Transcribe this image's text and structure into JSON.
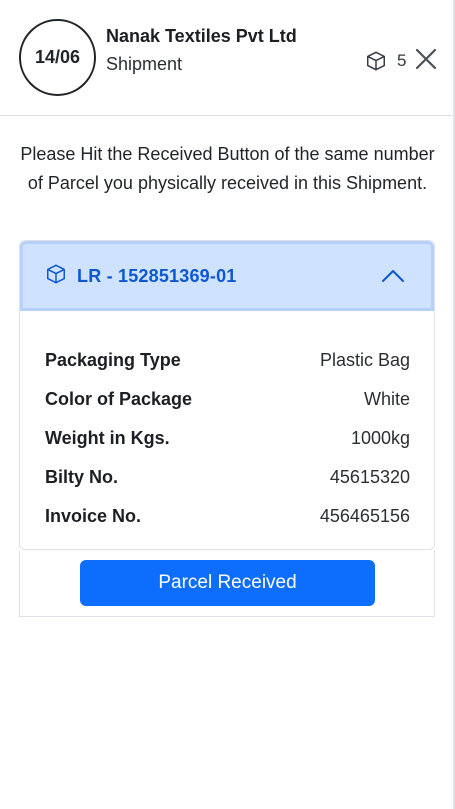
{
  "header": {
    "date": "14/06",
    "company": "Nanak Textiles Pvt Ltd",
    "subtitle": "Shipment",
    "parcel_count": "5",
    "box_icon": "box-icon",
    "close_icon": "close-icon"
  },
  "instruction": "Please Hit the Received Button of the same number of Parcel you physically received in this Shipment.",
  "parcel": {
    "lr_label": "LR - 152851369-01",
    "expanded": true,
    "details": [
      {
        "label": "Packaging Type",
        "value": "Plastic Bag"
      },
      {
        "label": "Color of Package",
        "value": "White"
      },
      {
        "label": "Weight in Kgs.",
        "value": "1000kg"
      },
      {
        "label": "Bilty No.",
        "value": "45615320"
      },
      {
        "label": "Invoice No.",
        "value": "456465156"
      }
    ]
  },
  "action": {
    "button_label": "Parcel Received"
  },
  "colors": {
    "accent": "#0d6efd",
    "accordion_header_bg": "#cfe2ff",
    "accordion_header_text": "#0c57d2"
  }
}
